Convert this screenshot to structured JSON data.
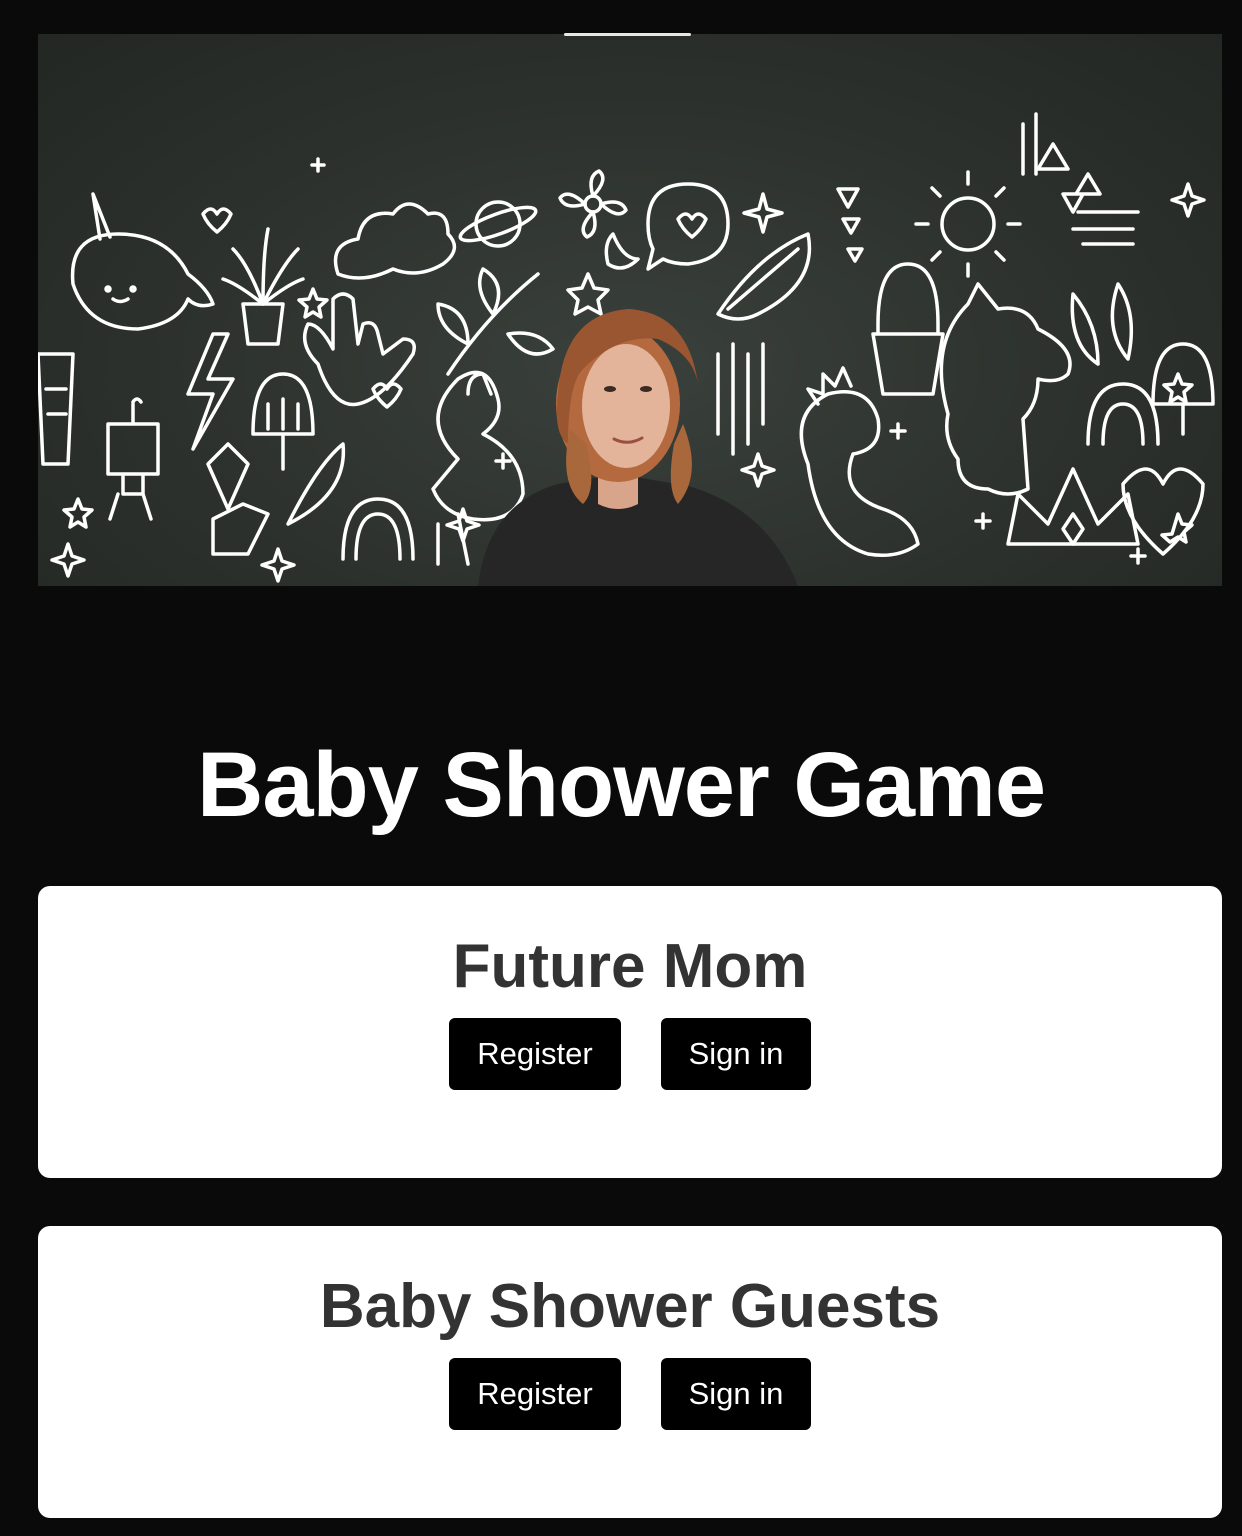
{
  "header": {
    "title": "Baby Shower Game"
  },
  "hero": {
    "image_description_icon": "doodle-banner-image"
  },
  "sections": [
    {
      "title": "Future Mom",
      "register_label": "Register",
      "signin_label": "Sign in"
    },
    {
      "title": "Baby Shower Guests",
      "register_label": "Register",
      "signin_label": "Sign in"
    }
  ],
  "colors": {
    "background": "#0a0a0a",
    "card": "#ffffff",
    "button": "#000000",
    "card_title": "#333333",
    "hero_board": "#2c312d"
  }
}
